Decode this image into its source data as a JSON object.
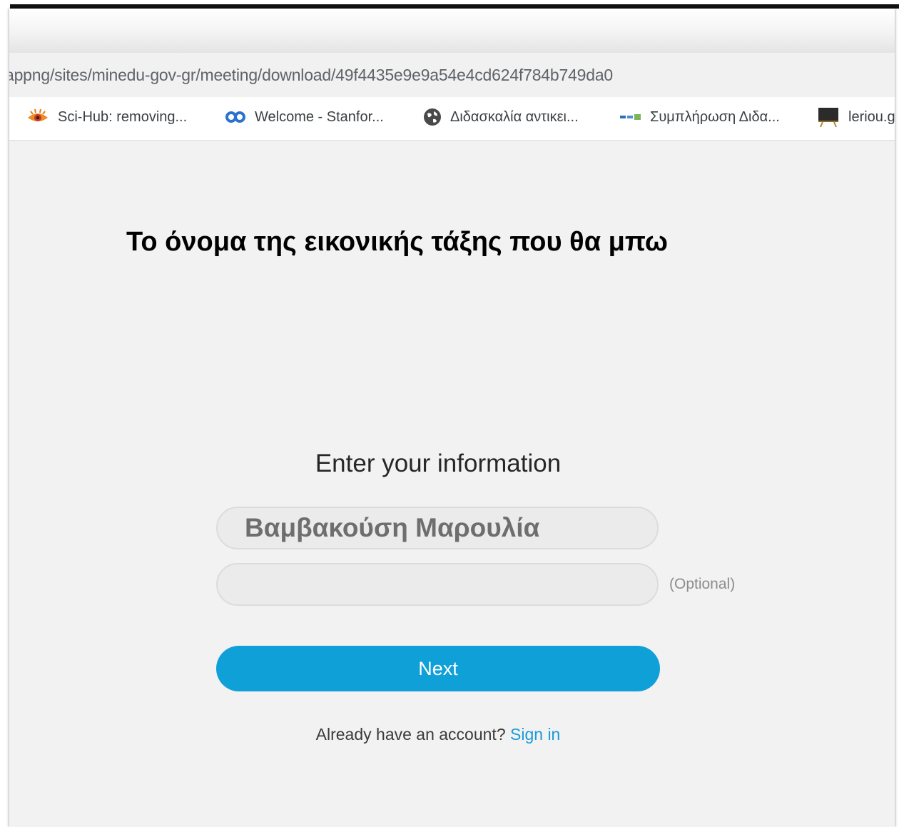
{
  "browser": {
    "url": "appng/sites/minedu-gov-gr/meeting/download/49f4435e9e9a54e4cd624f784b749da0",
    "bookmarks": [
      {
        "label": "Sci-Hub: removing...",
        "icon": "scihub-raven-icon"
      },
      {
        "label": "Welcome - Stanfor...",
        "icon": "coursera-infinity-icon"
      },
      {
        "label": "Διδασκαλία αντικει...",
        "icon": "globe-icon"
      },
      {
        "label": "Συμπλήρωση Διδα...",
        "icon": "gov-logo-icon"
      },
      {
        "label": "leriou.g",
        "icon": "blackboard-icon"
      }
    ]
  },
  "annotation": {
    "text": "Το όνομα της εικονικής τάξης που θα μπω"
  },
  "form": {
    "title": "Enter your information",
    "name_value": "Βαμβακούση Μαρουλία",
    "email_value": "",
    "optional_label": "(Optional)",
    "next_label": "Next",
    "account_prompt": "Already have an account?",
    "sign_in_label": "Sign in"
  },
  "colors": {
    "accent": "#0fa0d8",
    "link": "#1a9bd7",
    "background": "#f2f2f2"
  }
}
